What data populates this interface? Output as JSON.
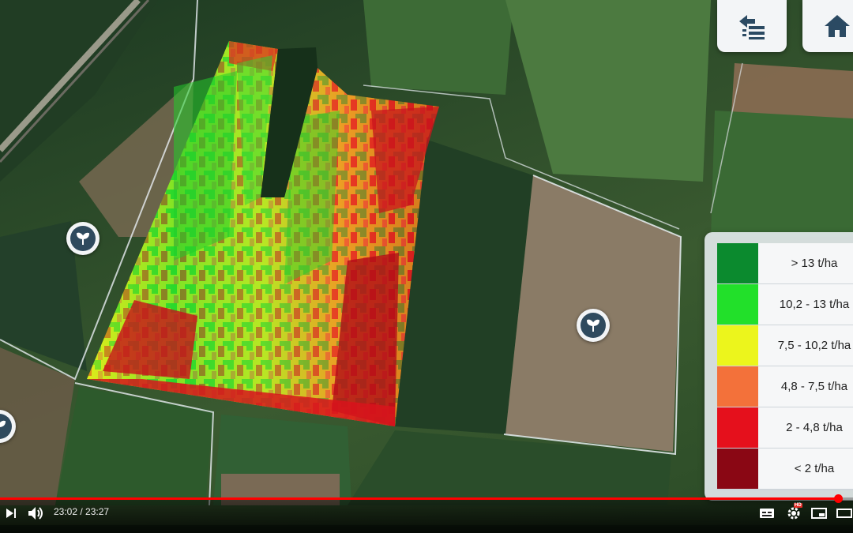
{
  "toolbar": {
    "back_list_icon": "back-list-icon",
    "home_icon": "home-icon"
  },
  "legend": {
    "items": [
      {
        "label": "> 13 t/ha",
        "color": "#0b8a2e"
      },
      {
        "label": "10,2 - 13 t/ha",
        "color": "#22e02a"
      },
      {
        "label": "7,5 - 10,2 t/ha",
        "color": "#ecf51c"
      },
      {
        "label": "4,8 - 7,5 t/ha",
        "color": "#f3713a"
      },
      {
        "label": "2 - 4,8 t/ha",
        "color": "#e5101c"
      },
      {
        "label": "< 2 t/ha",
        "color": "#8a0714"
      }
    ]
  },
  "field_markers": [
    "plant-icon",
    "plant-icon",
    "plant-icon"
  ],
  "player": {
    "time": "23:02 / 23:27",
    "progress": 0.982,
    "accent": "#ff0000"
  }
}
